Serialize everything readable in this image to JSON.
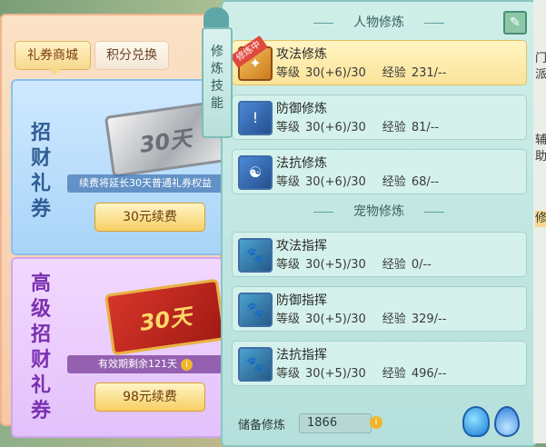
{
  "left": {
    "tabs": [
      {
        "label": "礼券商城",
        "active": true
      },
      {
        "label": "积分兑换",
        "active": false
      }
    ],
    "cards": [
      {
        "title_chars": [
          "招",
          "财",
          "礼",
          "券"
        ],
        "ticket_text": "30天",
        "info": "续费将延长30天普通礼券权益",
        "button": "30元续费"
      },
      {
        "title_chars": [
          "高",
          "级",
          "招",
          "财",
          "礼",
          "券"
        ],
        "ticket_text": "30天",
        "info": "有效期剩余121天",
        "button": "98元续费"
      }
    ]
  },
  "vtab": {
    "chars": [
      "修",
      "炼",
      "技",
      "能"
    ]
  },
  "main": {
    "section_person": "人物修炼",
    "section_pet": "宠物修炼",
    "level_label": "等级",
    "exp_label": "经验",
    "person_skills": [
      {
        "name": "攻法修炼",
        "level": "30(+6)/30",
        "exp": "231/--",
        "badge": "修炼中",
        "icon": "attack-magic-icon"
      },
      {
        "name": "防御修炼",
        "level": "30(+6)/30",
        "exp": "81/--",
        "icon": "defense-icon"
      },
      {
        "name": "法抗修炼",
        "level": "30(+6)/30",
        "exp": "68/--",
        "icon": "magic-resist-icon"
      }
    ],
    "pet_skills": [
      {
        "name": "攻法指挥",
        "level": "30(+5)/30",
        "exp": "0/--",
        "icon": "pet-attack-icon"
      },
      {
        "name": "防御指挥",
        "level": "30(+5)/30",
        "exp": "329/--",
        "icon": "pet-defense-icon"
      },
      {
        "name": "法抗指挥",
        "level": "30(+5)/30",
        "exp": "496/--",
        "icon": "pet-resist-icon"
      }
    ],
    "reserve_label": "储备修炼",
    "reserve_value": "1866"
  },
  "edge": {
    "chars": [
      "门",
      "派",
      "辅",
      "助",
      "修"
    ]
  },
  "colors": {
    "accent_gold": "#f7cf63",
    "panel_teal": "#cfeee9",
    "highlight": "#fbe49a"
  }
}
